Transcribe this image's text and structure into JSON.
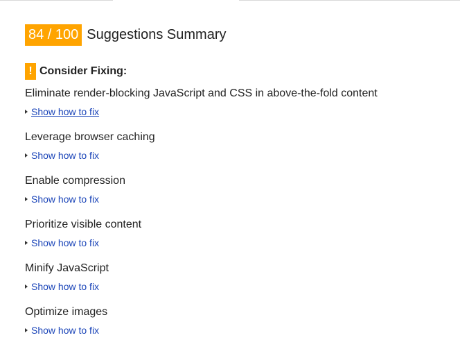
{
  "summary": {
    "score": "84 / 100",
    "title": "Suggestions Summary",
    "accent_color": "#ffa400"
  },
  "section": {
    "icon": "exclamation-icon",
    "icon_glyph": "!",
    "title": "Consider Fixing:"
  },
  "rules": [
    {
      "title": "Eliminate render-blocking JavaScript and CSS in above-the-fold content",
      "link": "Show how to fix",
      "underlined": true
    },
    {
      "title": "Leverage browser caching",
      "link": "Show how to fix",
      "underlined": false
    },
    {
      "title": "Enable compression",
      "link": "Show how to fix",
      "underlined": false
    },
    {
      "title": "Prioritize visible content",
      "link": "Show how to fix",
      "underlined": false
    },
    {
      "title": "Minify JavaScript",
      "link": "Show how to fix",
      "underlined": false
    },
    {
      "title": "Optimize images",
      "link": "Show how to fix",
      "underlined": false
    }
  ]
}
